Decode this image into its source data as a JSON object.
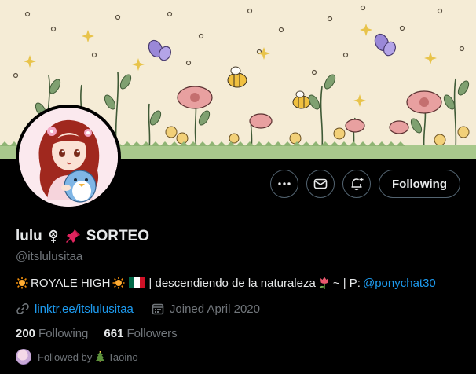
{
  "profile": {
    "name": "lulu",
    "name_suffix": "SORTEO",
    "handle": "@itslulusitaa",
    "bio_part1": "ROYALE HIGH",
    "bio_part2": "| descendiendo de la naturaleza",
    "bio_part3": "~ | P:",
    "bio_mention": "@ponychat30",
    "link": "linktr.ee/itslulusitaa",
    "joined": "Joined April 2020",
    "following_count": "200",
    "following_label": "Following",
    "followers_count": "661",
    "followers_label": "Followers",
    "followed_by_prefix": "Followed by",
    "followed_by_name": "Taoino"
  },
  "actions": {
    "follow_label": "Following",
    "more_icon": "more-icon",
    "message_icon": "mail-icon",
    "notify_icon": "bell-plus-icon"
  },
  "colors": {
    "accent": "#1d9bf0",
    "muted": "#71767b",
    "text": "#e7e9ea",
    "background": "#000000"
  }
}
